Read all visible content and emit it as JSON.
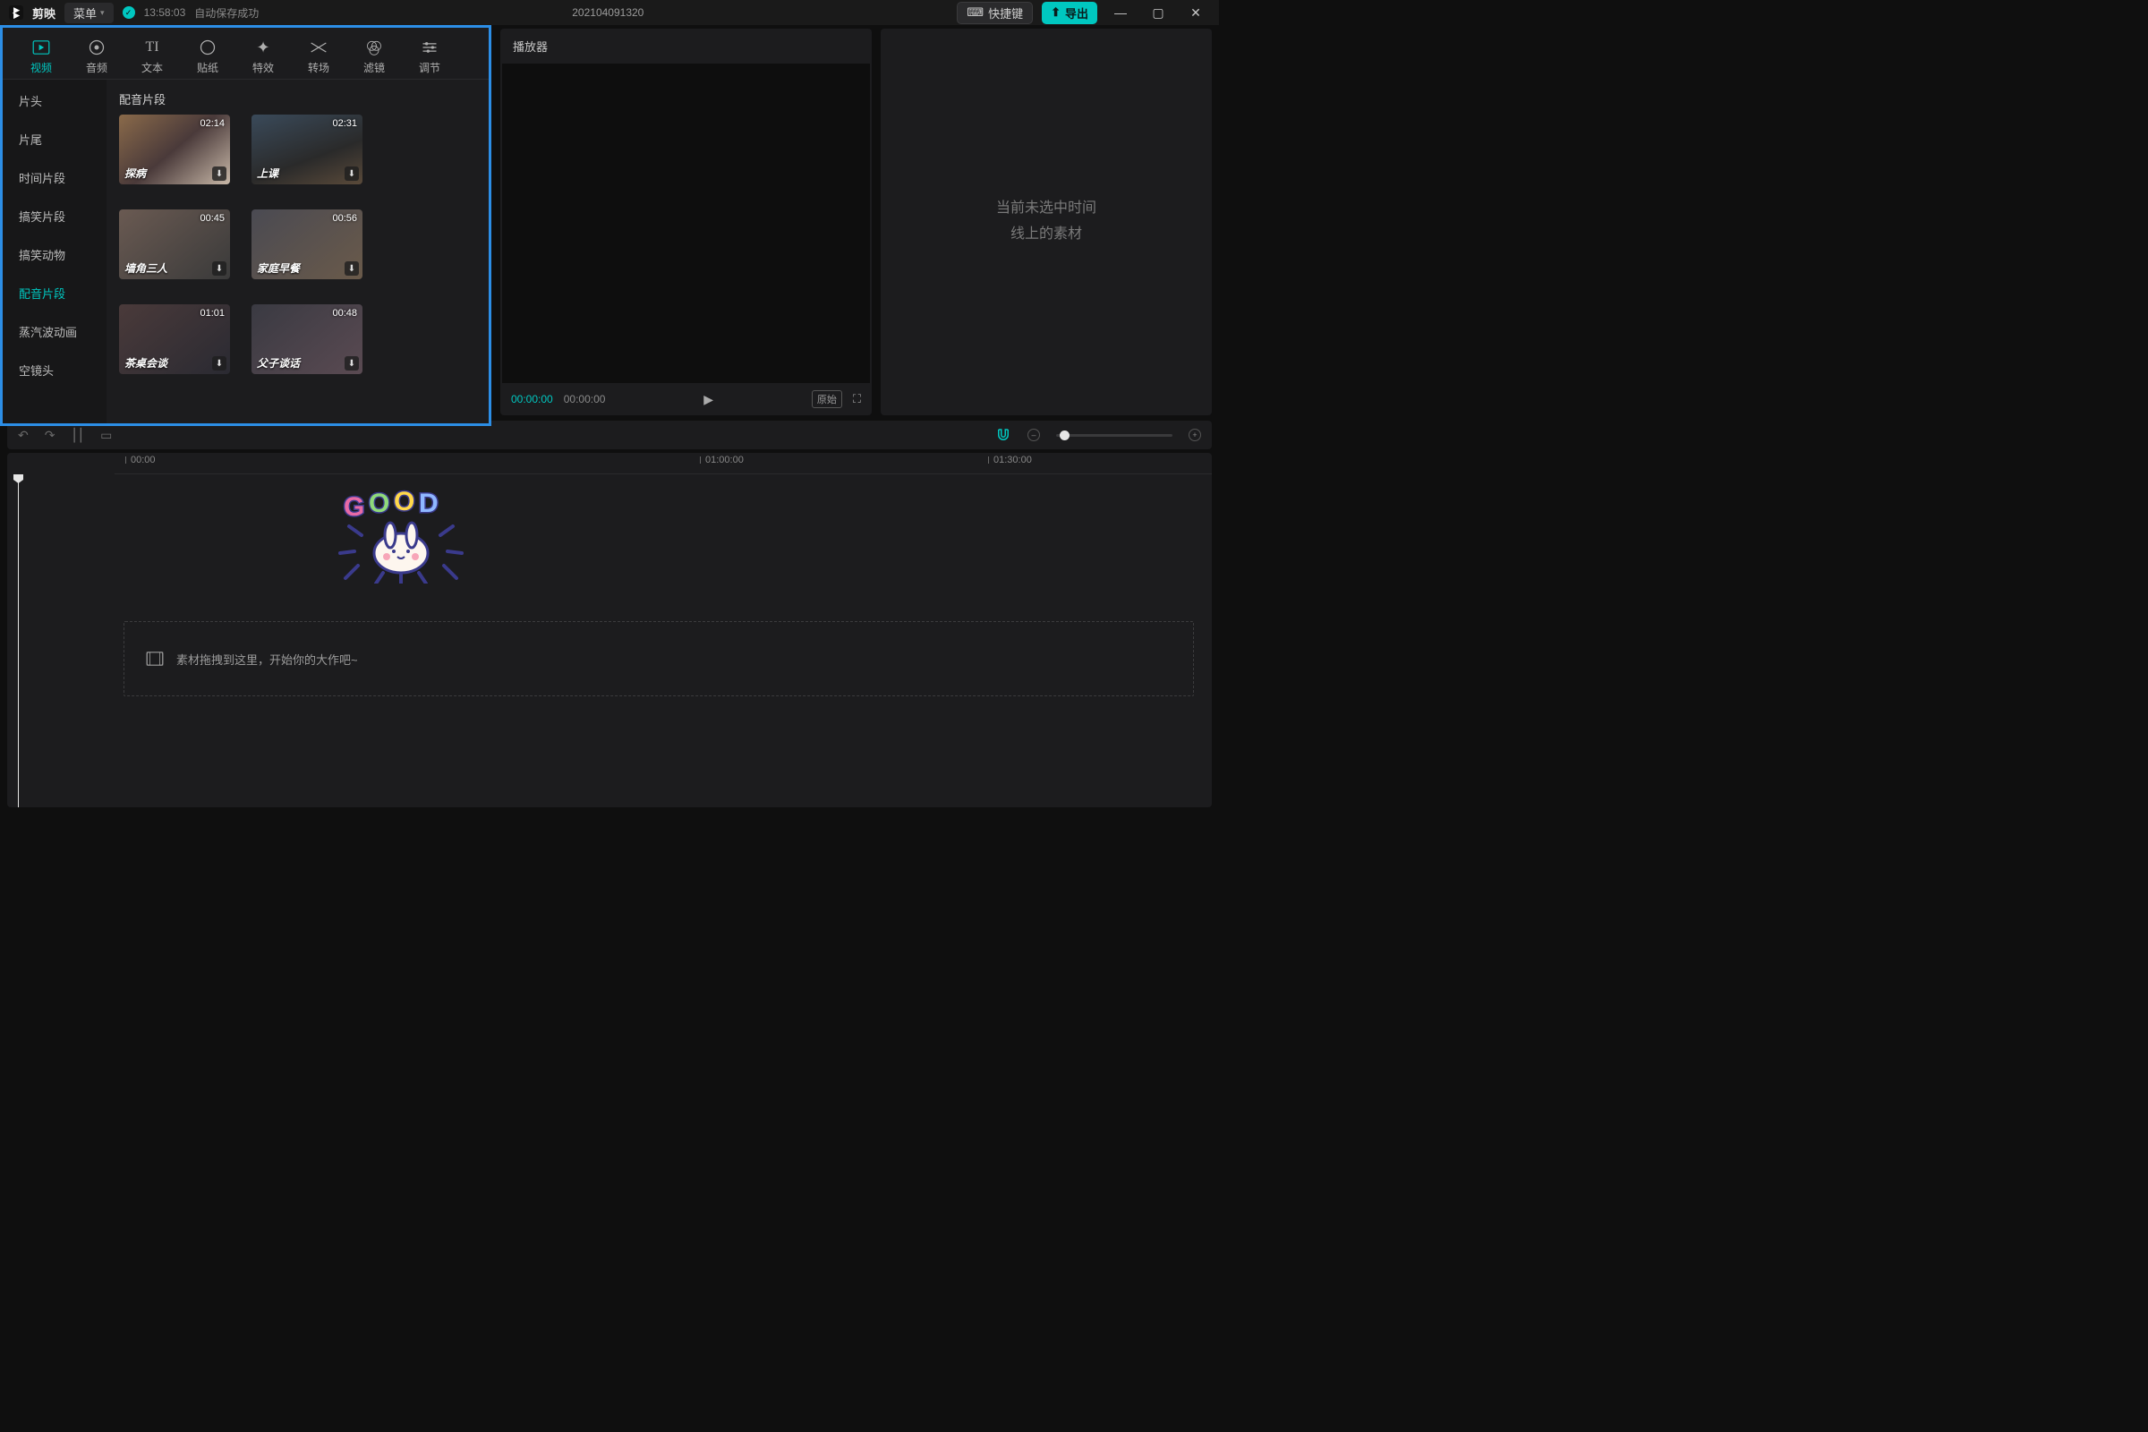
{
  "titlebar": {
    "app_name": "剪映",
    "menu_label": "菜单",
    "autosave_time": "13:58:03",
    "autosave_text": "自动保存成功",
    "project_name": "202104091320",
    "shortcut_label": "快捷键",
    "export_label": "导出"
  },
  "library": {
    "tabs": [
      {
        "id": "video",
        "label": "视频"
      },
      {
        "id": "audio",
        "label": "音频"
      },
      {
        "id": "text",
        "label": "文本"
      },
      {
        "id": "sticker",
        "label": "贴纸"
      },
      {
        "id": "effect",
        "label": "特效"
      },
      {
        "id": "transition",
        "label": "转场"
      },
      {
        "id": "filter",
        "label": "滤镜"
      },
      {
        "id": "adjust",
        "label": "调节"
      }
    ],
    "active_tab": "video",
    "categories": [
      "片头",
      "片尾",
      "时间片段",
      "搞笑片段",
      "搞笑动物",
      "配音片段",
      "蒸汽波动画",
      "空镜头"
    ],
    "active_category": "配音片段",
    "section_title": "配音片段",
    "clips": [
      {
        "caption": "探病",
        "duration": "02:14"
      },
      {
        "caption": "上课",
        "duration": "02:31"
      },
      {
        "caption": "墙角三人",
        "duration": "00:45"
      },
      {
        "caption": "家庭早餐",
        "duration": "00:56"
      },
      {
        "caption": "茶桌会谈",
        "duration": "01:01"
      },
      {
        "caption": "父子谈话",
        "duration": "00:48"
      }
    ]
  },
  "player": {
    "header": "播放器",
    "time_current": "00:00:00",
    "time_total": "00:00:00",
    "original_label": "原始"
  },
  "inspector": {
    "empty_line1": "当前未选中时间",
    "empty_line2": "线上的素材"
  },
  "timeline": {
    "ruler": [
      "00:00",
      "01:00:00",
      "01:30:00"
    ],
    "drop_hint": "素材拖拽到这里，开始你的大作吧~"
  }
}
